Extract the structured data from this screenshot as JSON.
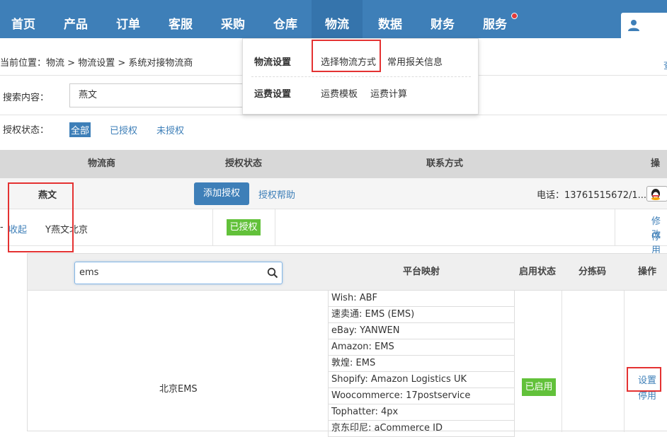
{
  "nav": {
    "items": [
      "首页",
      "产品",
      "订单",
      "客服",
      "采购",
      "仓库",
      "物流",
      "数据",
      "财务",
      "服务"
    ],
    "active": "物流"
  },
  "breadcrumb": {
    "prefix": "当前位置：",
    "parts": [
      "物流",
      "物流设置",
      "系统对接物流商"
    ],
    "sep": ">",
    "more": "查"
  },
  "dropdown": {
    "groups": [
      {
        "title": "物流设置",
        "items": [
          "选择物流方式",
          "常用报关信息"
        ]
      },
      {
        "title": "运费设置",
        "items": [
          "运费模板",
          "运费计算"
        ]
      }
    ]
  },
  "search": {
    "label": "搜索内容：",
    "value": "燕文"
  },
  "filter": {
    "label": "授权状态：",
    "options": [
      "全部",
      "已授权",
      "未授权"
    ],
    "active": "全部"
  },
  "table": {
    "headers": [
      "物流商",
      "授权状态",
      "联系方式",
      "操作"
    ],
    "carrier": {
      "name": "燕文",
      "add_button": "添加授权",
      "help_link": "授权帮助",
      "phone": "电话：13761515672/1..."
    },
    "account": {
      "collapse": "收起",
      "dash": "-",
      "name": "Y燕文北京",
      "status": "已授权",
      "actions": [
        "修改",
        "停用"
      ]
    }
  },
  "inner": {
    "search_value": "ems",
    "headers": [
      "平台映射",
      "启用状态",
      "分拣码",
      "操作"
    ],
    "row": {
      "name": "北京EMS",
      "mappings": [
        "Wish:  ABF",
        "速卖通:  EMS (EMS)",
        "eBay:  YANWEN",
        "Amazon:  EMS",
        "敦煌:  EMS",
        "Shopify:  Amazon Logistics UK",
        "Woocommerce:  17postservice",
        "Tophatter:  4px",
        "京东印尼:  aCommerce ID"
      ],
      "status": "已启用",
      "actions": [
        "设置",
        "停用"
      ]
    }
  },
  "colors": {
    "nav_bg": "#3e7fb8",
    "accent": "#3e7fb8",
    "green": "#62c13a",
    "highlight": "#e43232"
  }
}
